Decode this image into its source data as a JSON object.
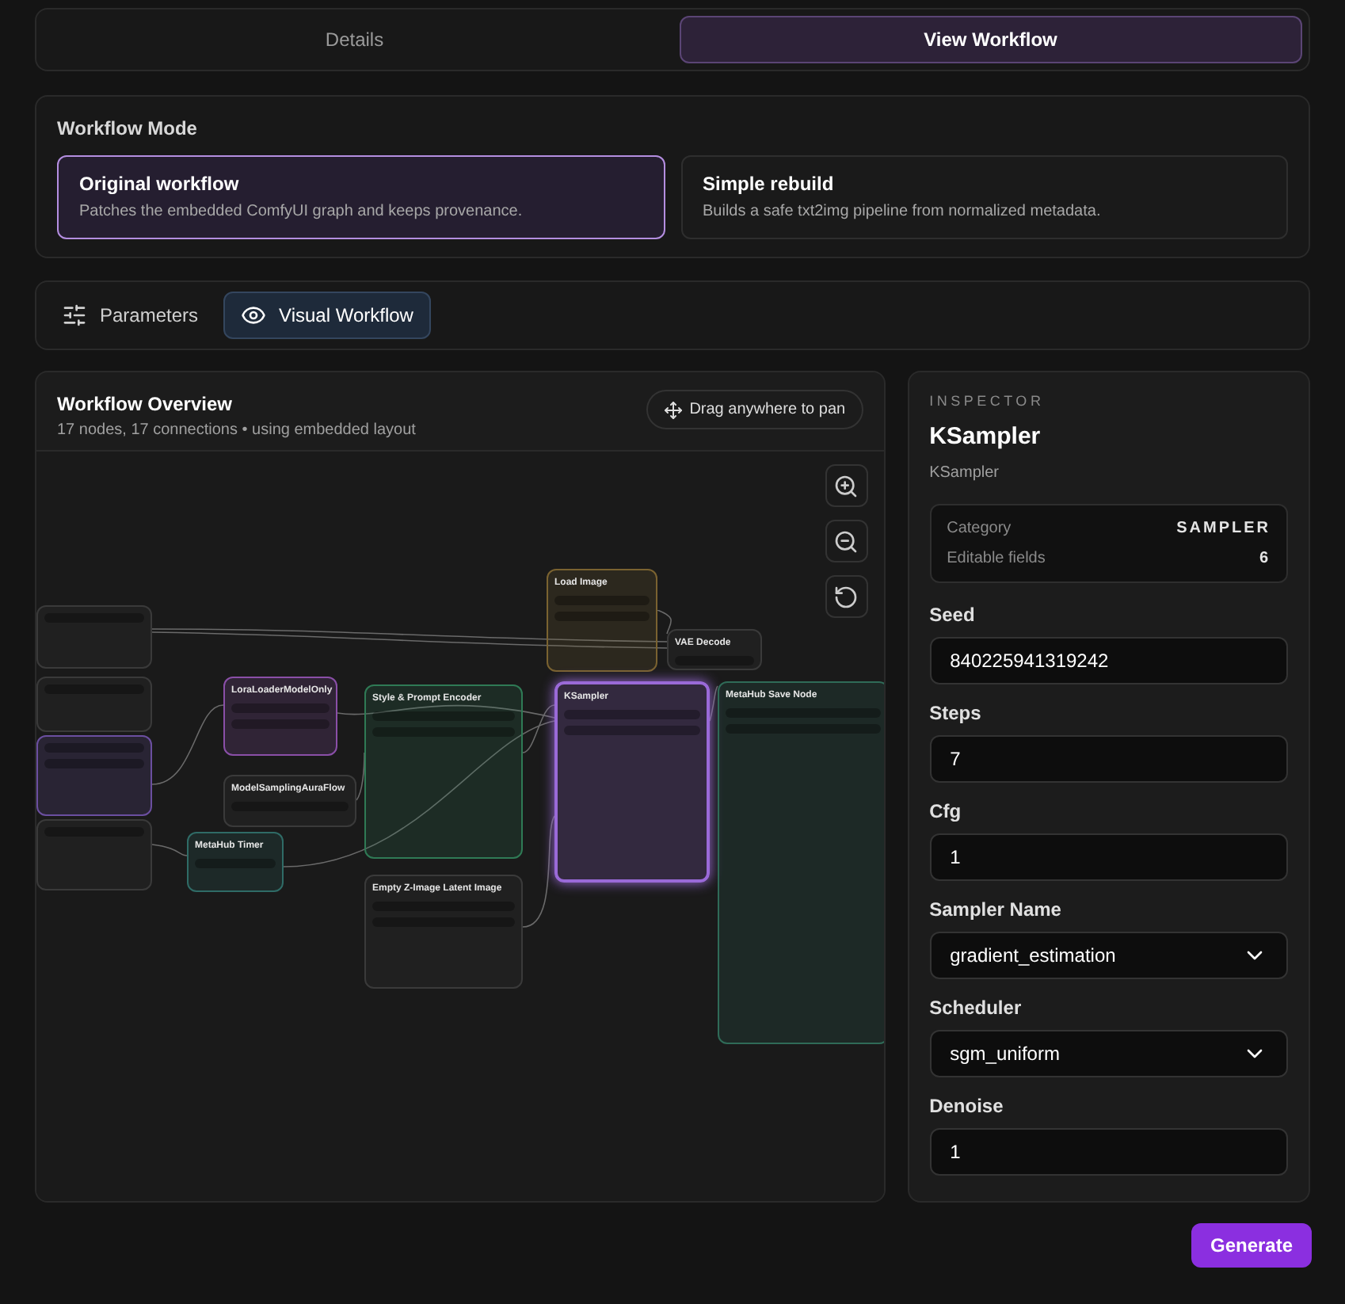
{
  "view_tabs": [
    {
      "label": "Details",
      "selected": false
    },
    {
      "label": "View Workflow",
      "selected": true
    }
  ],
  "workflow_mode": {
    "title": "Workflow Mode",
    "options": [
      {
        "title": "Original workflow",
        "description": "Patches the embedded ComfyUI graph and keeps provenance.",
        "selected": true
      },
      {
        "title": "Simple rebuild",
        "description": "Builds a safe txt2img pipeline from normalized metadata.",
        "selected": false
      }
    ]
  },
  "sub_tabs": [
    {
      "label": "Parameters",
      "selected": false
    },
    {
      "label": "Visual Workflow",
      "selected": true
    }
  ],
  "overview": {
    "title": "Workflow Overview",
    "subtitle": "17 nodes, 17 connections • using embedded layout",
    "pan_hint": "Drag anywhere to pan",
    "nodes": [
      {
        "color": "#3a3a3a",
        "selected": false
      },
      {
        "color": "#3a3a3a",
        "selected": false
      },
      {
        "color": "#6b4fa0",
        "selected": false
      },
      {
        "color": "#3a3a3a",
        "selected": false
      },
      {
        "color": "#8a4fa8",
        "selected": false,
        "title": "LoraLoaderModelOnly"
      },
      {
        "color": "#3a3a3a",
        "selected": false,
        "title": "ModelSamplingAuraFlow"
      },
      {
        "color": "#2f6b66",
        "selected": false,
        "title": "MetaHub Timer"
      },
      {
        "color": "#2f7a55",
        "selected": false,
        "title": "Style & Prompt Encoder"
      },
      {
        "color": "#3a3a3a",
        "selected": false,
        "title": "Empty Z-Image Latent Image"
      },
      {
        "color": "#7a6230",
        "selected": false,
        "title": "Load Image"
      },
      {
        "color": "#9a6ad8",
        "selected": true,
        "title": "KSampler"
      },
      {
        "color": "#3a3a3a",
        "selected": false,
        "title": "VAE Decode"
      },
      {
        "color": "#2f6b58",
        "selected": false,
        "title": "MetaHub Save Node"
      }
    ]
  },
  "inspector": {
    "eyebrow": "INSPECTOR",
    "title": "KSampler",
    "subtitle": "KSampler",
    "summary": [
      {
        "label": "Category",
        "value": "SAMPLER"
      },
      {
        "label": "Editable fields",
        "value": "6"
      }
    ],
    "fields": [
      {
        "label": "Seed",
        "kind": "input",
        "value": "840225941319242"
      },
      {
        "label": "Steps",
        "kind": "input",
        "value": "7"
      },
      {
        "label": "Cfg",
        "kind": "input",
        "value": "1"
      },
      {
        "label": "Sampler Name",
        "kind": "select",
        "value": "gradient_estimation"
      },
      {
        "label": "Scheduler",
        "kind": "select",
        "value": "sgm_uniform"
      },
      {
        "label": "Denoise",
        "kind": "input",
        "value": "1"
      }
    ]
  },
  "generate_button": "Generate"
}
